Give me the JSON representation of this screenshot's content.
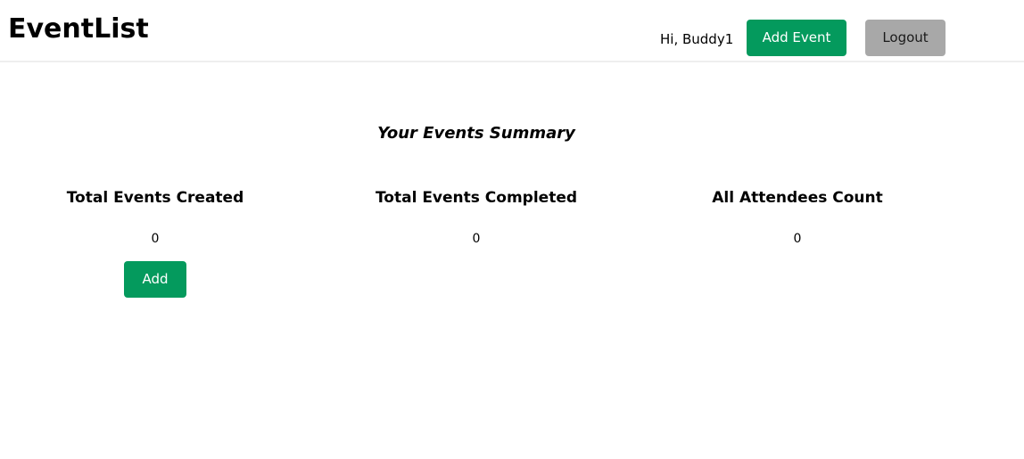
{
  "header": {
    "brand": "EventList",
    "greeting": "Hi, Buddy1",
    "add_event_label": "Add Event",
    "logout_label": "Logout"
  },
  "main": {
    "summary_title": "Your Events Summary",
    "stats": [
      {
        "label": "Total Events Created",
        "value": "0"
      },
      {
        "label": "Total Events Completed",
        "value": "0"
      },
      {
        "label": "All Attendees Count",
        "value": "0"
      }
    ],
    "add_label": "Add"
  },
  "colors": {
    "primary_green": "#049a5d",
    "logout_gray": "#a8a8a8",
    "divider": "#eeeeee"
  }
}
